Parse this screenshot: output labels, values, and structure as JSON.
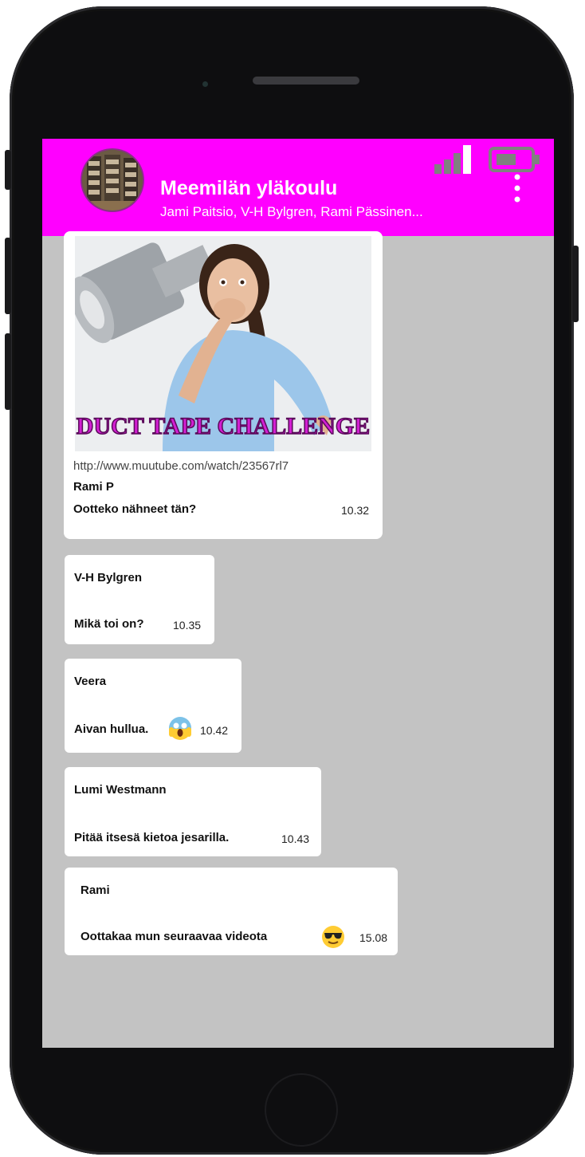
{
  "header": {
    "title": "Meemilän yläkoulu",
    "participants": "Jami Paitsio, V-H Bylgren, Rami Pässinen..."
  },
  "colors": {
    "header_bg": "#ff00ff",
    "chat_bg": "#c3c3c3",
    "bubble_bg": "#ffffff",
    "video_caption": "#d21fd2"
  },
  "messages": [
    {
      "video_caption": "DUCT TAPE CHALLENGE",
      "link": "http://www.muutube.com/watch/23567rl7",
      "sender": "Rami P",
      "text": "Ootteko nähneet tän?",
      "time": "10.32"
    },
    {
      "sender": "V-H Bylgren",
      "text": "Mikä toi on?",
      "time": "10.35"
    },
    {
      "sender": "Veera",
      "text": "Aivan hullua.",
      "emoji": "screaming-face-icon",
      "time": "10.42"
    },
    {
      "sender": "Lumi Westmann",
      "text": "Pitää itsesä kietoa jesarilla.",
      "time": "10.43"
    },
    {
      "sender": "Rami",
      "text": "Oottakaa mun seuraavaa videota",
      "emoji": "sunglasses-face-icon",
      "time": "15.08"
    }
  ],
  "icons": [
    "signal-icon",
    "battery-icon",
    "more-options-icon",
    "group-avatar"
  ]
}
